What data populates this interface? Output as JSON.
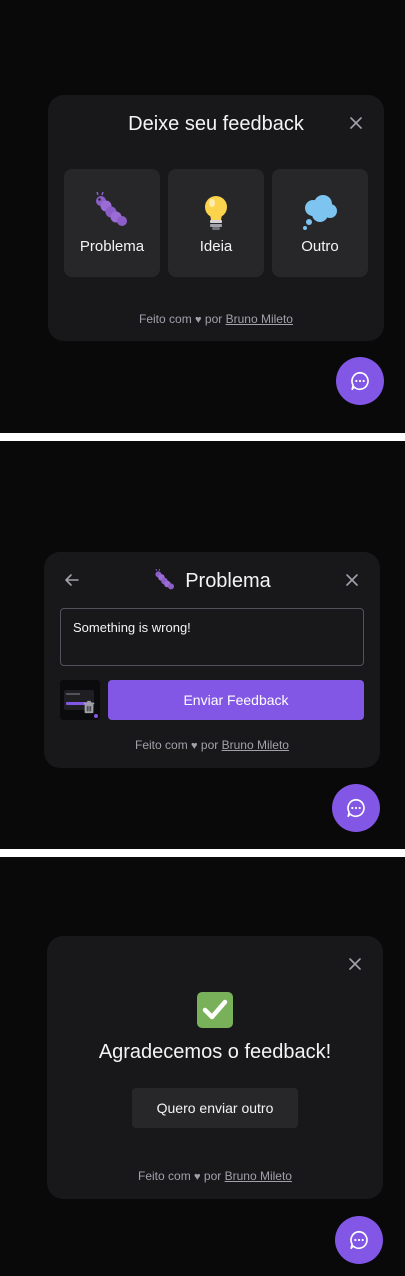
{
  "select_type": {
    "title": "Deixe seu feedback",
    "options": [
      {
        "label": "Problema",
        "icon": "worm-icon"
      },
      {
        "label": "Ideia",
        "icon": "lightbulb-icon"
      },
      {
        "label": "Outro",
        "icon": "thought-bubble-icon"
      }
    ]
  },
  "content_step": {
    "title": "Problema",
    "comment_value": "Something is wrong!",
    "submit_label": "Enviar Feedback"
  },
  "success_step": {
    "message": "Agradecemos o feedback!",
    "again_label": "Quero enviar outro"
  },
  "footer": {
    "prefix": "Feito com",
    "heart": "♥",
    "by": "por",
    "author": "Bruno Mileto"
  },
  "colors": {
    "brand": "#8257e5",
    "surface": "#18181b",
    "surface_secondary": "#27272a",
    "background": "#09090a",
    "text_primary": "#f4f4f5",
    "text_secondary": "#a1a1aa",
    "stroke": "#52525b"
  }
}
